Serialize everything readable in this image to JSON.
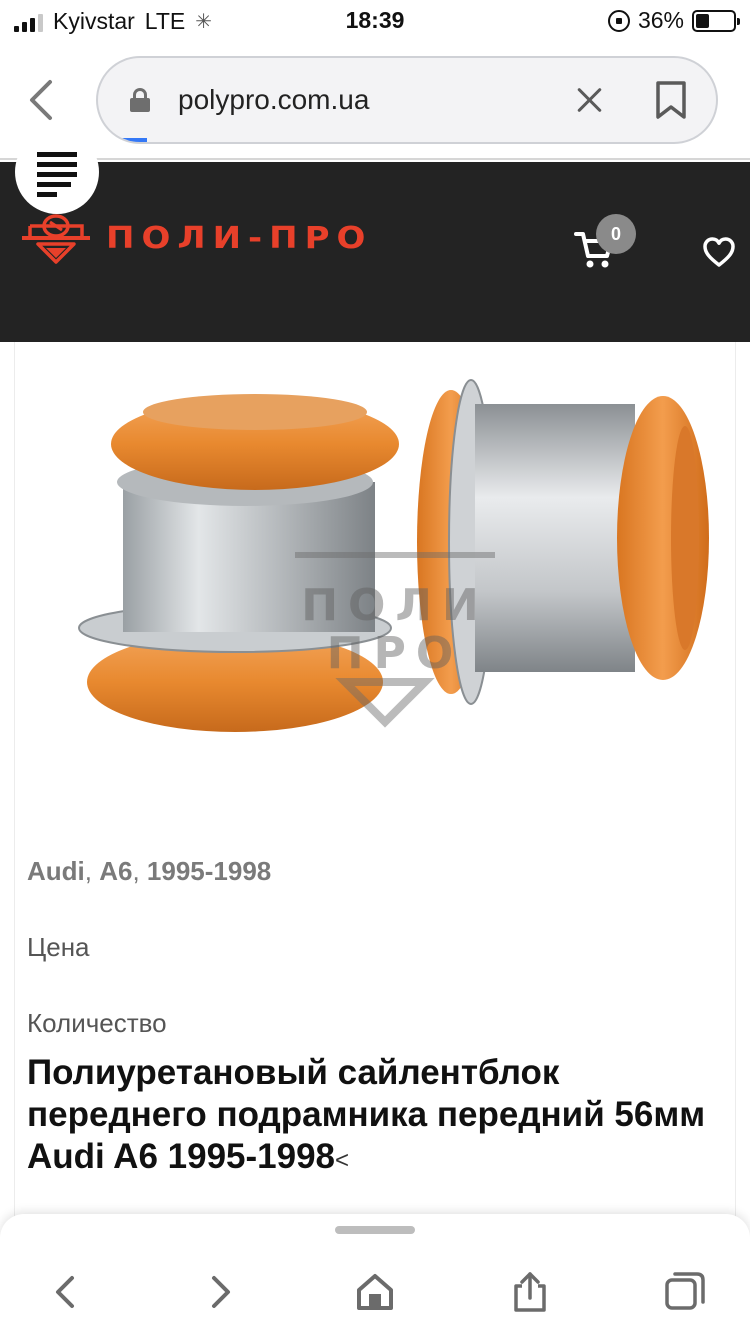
{
  "status_bar": {
    "carrier": "Kyivstar",
    "network": "LTE",
    "time": "18:39",
    "battery": "36%",
    "battery_level": 0.36
  },
  "browser": {
    "url": "polypro.com.ua",
    "load_progress": 0.08
  },
  "header": {
    "logo_text": "ПОЛИ-ПРО",
    "cart_count": "0",
    "accent_color": "#e8402a",
    "background_color": "#232323"
  },
  "product": {
    "compat_brand": "Audi",
    "compat_model": "A6",
    "compat_years": "1995-1998",
    "price_label": "Цена",
    "quantity_label": "Количество",
    "title": "Полиуретановый сайлентблок переднего подрамника передний 56мм Audi A6 1995-1998",
    "title_suffix": "<",
    "image_watermark": "ПОЛИ ПРО"
  },
  "icons": {
    "back": "chevron-left-icon",
    "lock": "lock-icon",
    "clear": "close-icon",
    "bookmark": "bookmark-icon",
    "cart": "cart-icon",
    "heart": "heart-icon",
    "menu": "menu-icon",
    "toolbar": [
      "back-icon",
      "forward-icon",
      "home-icon",
      "share-icon",
      "tabs-icon"
    ]
  }
}
